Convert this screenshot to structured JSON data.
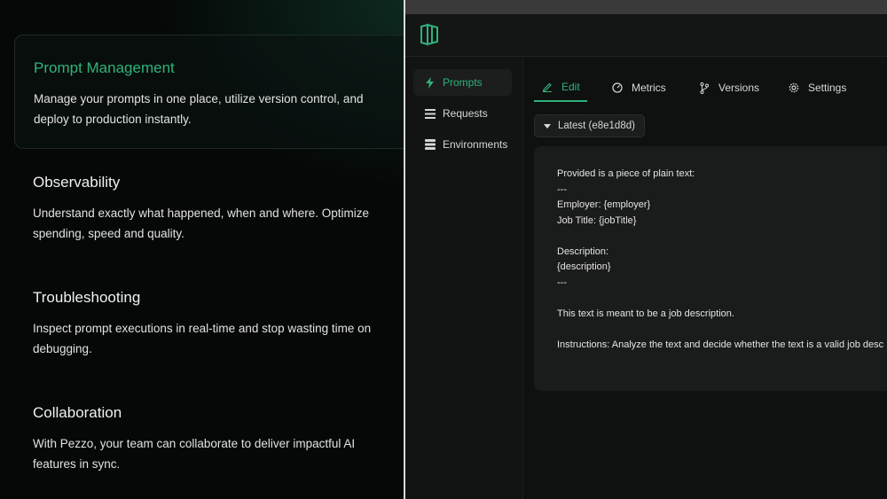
{
  "features": [
    {
      "title": "Prompt Management",
      "description": "Manage your prompts in one place, utilize version control, and deploy to production instantly.",
      "active": true
    },
    {
      "title": "Observability",
      "description": "Understand exactly what happened, when and where. Optimize spending, speed and quality.",
      "active": false
    },
    {
      "title": "Troubleshooting",
      "description": "Inspect prompt executions in real-time and stop wasting time on debugging.",
      "active": false
    },
    {
      "title": "Collaboration",
      "description": "With Pezzo, your team can collaborate to deliver impactful AI features in sync.",
      "active": false
    }
  ],
  "app": {
    "brand_color": "#2fb37a",
    "logo_icon": "pezzo-logo-icon",
    "sidebar": [
      {
        "label": "Prompts",
        "icon": "lightning-icon",
        "active": true
      },
      {
        "label": "Requests",
        "icon": "list-icon",
        "active": false
      },
      {
        "label": "Environments",
        "icon": "database-icon",
        "active": false
      }
    ],
    "tabs": [
      {
        "label": "Edit",
        "icon": "pencil-icon",
        "active": true
      },
      {
        "label": "Metrics",
        "icon": "gauge-icon",
        "active": false
      },
      {
        "label": "Versions",
        "icon": "branch-icon",
        "active": false
      },
      {
        "label": "Settings",
        "icon": "gear-icon",
        "active": false
      }
    ],
    "version_selector": "Latest (e8e1d8d)",
    "prompt_lines": [
      "Provided is a piece of plain text:",
      "---",
      "Employer: {employer}",
      "Job Title: {jobTitle}",
      "",
      "Description:",
      "{description}",
      "---",
      "",
      "This text is meant to be a job description.",
      "",
      "Instructions: Analyze the text and decide whether the text is a valid job desc"
    ]
  }
}
